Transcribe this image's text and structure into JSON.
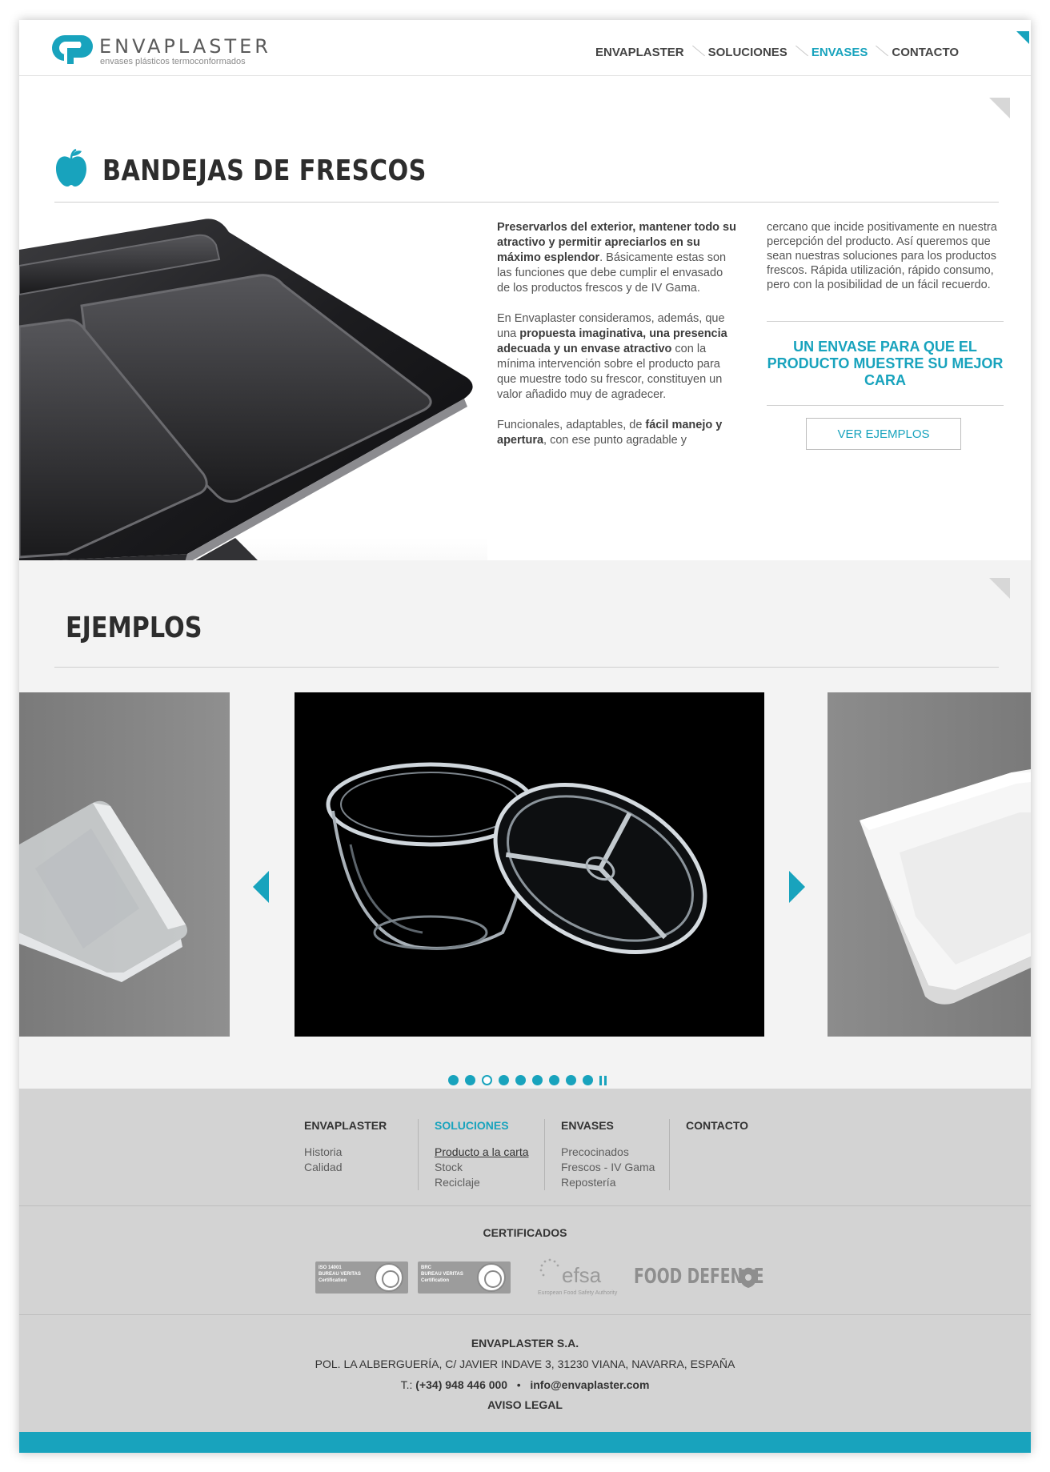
{
  "colors": {
    "accent": "#18a3bd",
    "text": "#444444",
    "footer_bg": "#d3d3d3",
    "section_bg": "#f3f3f3"
  },
  "logo": {
    "name": "ENVAPLASTER",
    "tagline": "envases plásticos termoconformados"
  },
  "nav": {
    "items": [
      {
        "label": "ENVAPLASTER",
        "active": false
      },
      {
        "label": "SOLUCIONES",
        "active": false
      },
      {
        "label": "ENVASES",
        "active": true
      },
      {
        "label": "CONTACTO",
        "active": false
      }
    ]
  },
  "section": {
    "icon": "apple-icon",
    "title": "BANDEJAS DE FRESCOS",
    "col1": {
      "p1": {
        "bold": "Preservarlos del exterior, mantener todo su atractivo y permitir apreciarlos en su máximo esplendor",
        "rest": ". Básicamente estas son las funciones que debe cumplir el envasado de los productos frescos y de IV Gama."
      },
      "p2": {
        "a": "En Envaplaster consideramos, además, que una ",
        "b": "propuesta imaginativa, una presencia adecuada y un envase atractivo",
        "c": " con la mínima intervención sobre el producto para que muestre todo su frescor, constituyen un valor añadido muy de agradecer."
      },
      "p3": {
        "a": "Funcionales, adaptables, de ",
        "b": "fácil manejo y apertura",
        "c": ", con ese punto agradable y"
      }
    },
    "col2": {
      "text": "cercano que incide positivamente en nuestra percepción del producto. Así queremos que sean nuestras soluciones para los productos frescos. Rápida utilización, rápido consumo, pero con la posibilidad de un fácil recuerdo.",
      "highlight": "UN ENVASE PARA QUE EL PRODUCTO MUESTRE SU MEJOR CARA",
      "button": "VER EJEMPLOS"
    }
  },
  "ejemplos": {
    "title": "EJEMPLOS",
    "dots": {
      "total": 9,
      "active_index": 2
    }
  },
  "footer": {
    "columns": [
      {
        "head": "ENVAPLASTER",
        "active": false,
        "links": [
          "Historia",
          "Calidad"
        ]
      },
      {
        "head": "SOLUCIONES",
        "active": true,
        "links": [
          "Producto a la carta",
          "Stock",
          "Reciclaje"
        ]
      },
      {
        "head": "ENVASES",
        "active": false,
        "links": [
          "Precocinados",
          "Frescos - IV Gama",
          "Repostería"
        ]
      },
      {
        "head": "CONTACTO",
        "active": false,
        "links": []
      }
    ],
    "certificados": {
      "title": "CERTIFICADOS",
      "bv1": {
        "line1": "ISO 14001",
        "line2": "BUREAU VERITAS",
        "line3": "Certification"
      },
      "bv2": {
        "line1": "BRC",
        "line2": "BUREAU VERITAS",
        "line3": "Certification"
      },
      "efsa": {
        "name": "efsa",
        "sub": "European Food Safety Authority"
      },
      "food_defense": "FOOD DEFENSE"
    },
    "company": {
      "name": "ENVAPLASTER S.A.",
      "address": "POL. LA ALBERGUERÍA, C/ JAVIER INDAVE 3, 31230 VIANA, NAVARRA, ESPAÑA",
      "phone_prefix": "T.: ",
      "phone": "(+34) 948 446 000",
      "bullet": "•",
      "email": "info@envaplaster.com",
      "legal": "AVISO LEGAL"
    }
  }
}
